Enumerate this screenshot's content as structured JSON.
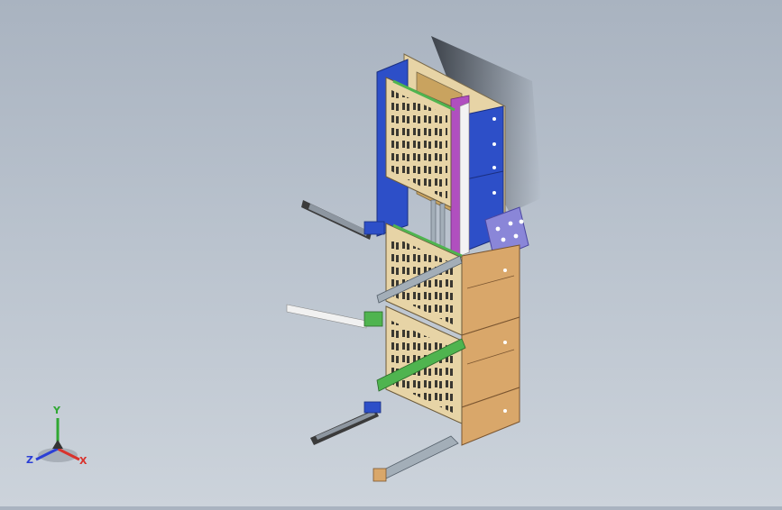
{
  "viewport": {
    "background_top": "#a9b3c0",
    "background_bottom": "#ccd3db"
  },
  "model": {
    "plate_color": "#e7d4a6",
    "frame_color": "#d9a76a",
    "blue_color": "#2d4fc8",
    "magenta_color": "#b04fbf",
    "green_color": "#4fb44f",
    "gray_rail_color": "#a3aeb8",
    "lavender_color": "#8a86d8",
    "dark_color": "#3b3b3b"
  },
  "triad": {
    "x_label": "X",
    "y_label": "Y",
    "z_label": "Z",
    "x_color": "#d9322c",
    "y_color": "#2fa832",
    "z_color": "#2b3fd6"
  }
}
